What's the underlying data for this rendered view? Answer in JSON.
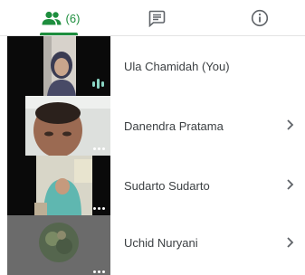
{
  "tabs": {
    "people": {
      "icon": "people-icon",
      "count": "(6)",
      "active": true
    },
    "chat": {
      "icon": "chat-icon"
    },
    "info": {
      "icon": "info-icon"
    }
  },
  "colors": {
    "accent": "#1e8e3e",
    "text": "#3c4043",
    "divider": "#e3e3e3"
  },
  "participants": [
    {
      "name": "Ula Chamidah (You)",
      "status": "speaking-indicator",
      "has_menu": false
    },
    {
      "name": "Danendra Pratama",
      "status": "more-options",
      "has_menu": true
    },
    {
      "name": "Sudarto Sudarto",
      "status": "more-options",
      "has_menu": true
    },
    {
      "name": "Uchid Nuryani",
      "status": "more-options",
      "has_menu": true
    }
  ]
}
